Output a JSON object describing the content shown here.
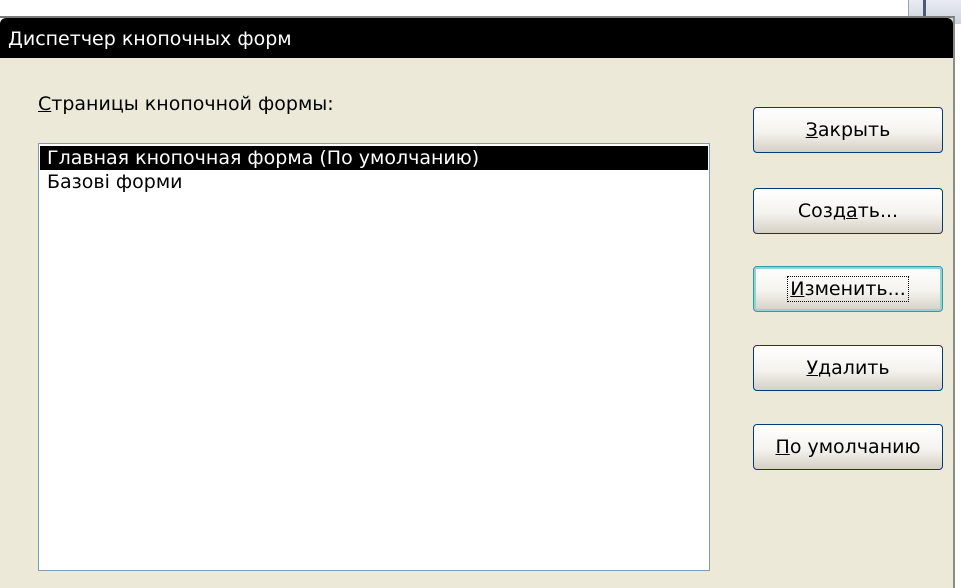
{
  "window": {
    "title": "Диспетчер кнопочных форм"
  },
  "pages_label": {
    "underlined": "С",
    "rest": "траницы кнопочной формы:"
  },
  "list": {
    "items": [
      {
        "label": "Главная кнопочная форма (По умолчанию)",
        "selected": true
      },
      {
        "label": "Базові форми",
        "selected": false
      }
    ]
  },
  "buttons": {
    "close": {
      "pre": "",
      "key": "З",
      "post": "акрыть"
    },
    "create": {
      "pre": "Созд",
      "key": "а",
      "post": "ть..."
    },
    "edit": {
      "pre": "",
      "key": "И",
      "post": "зменить..."
    },
    "delete": {
      "pre": "",
      "key": "У",
      "post": "далить"
    },
    "default": {
      "pre": "",
      "key": "П",
      "post": "о умолчанию"
    }
  },
  "colors": {
    "titlebar": "#000000",
    "client_bg": "#ece9d8",
    "selection": "#000000",
    "focus_border": "#2f9ea0"
  }
}
